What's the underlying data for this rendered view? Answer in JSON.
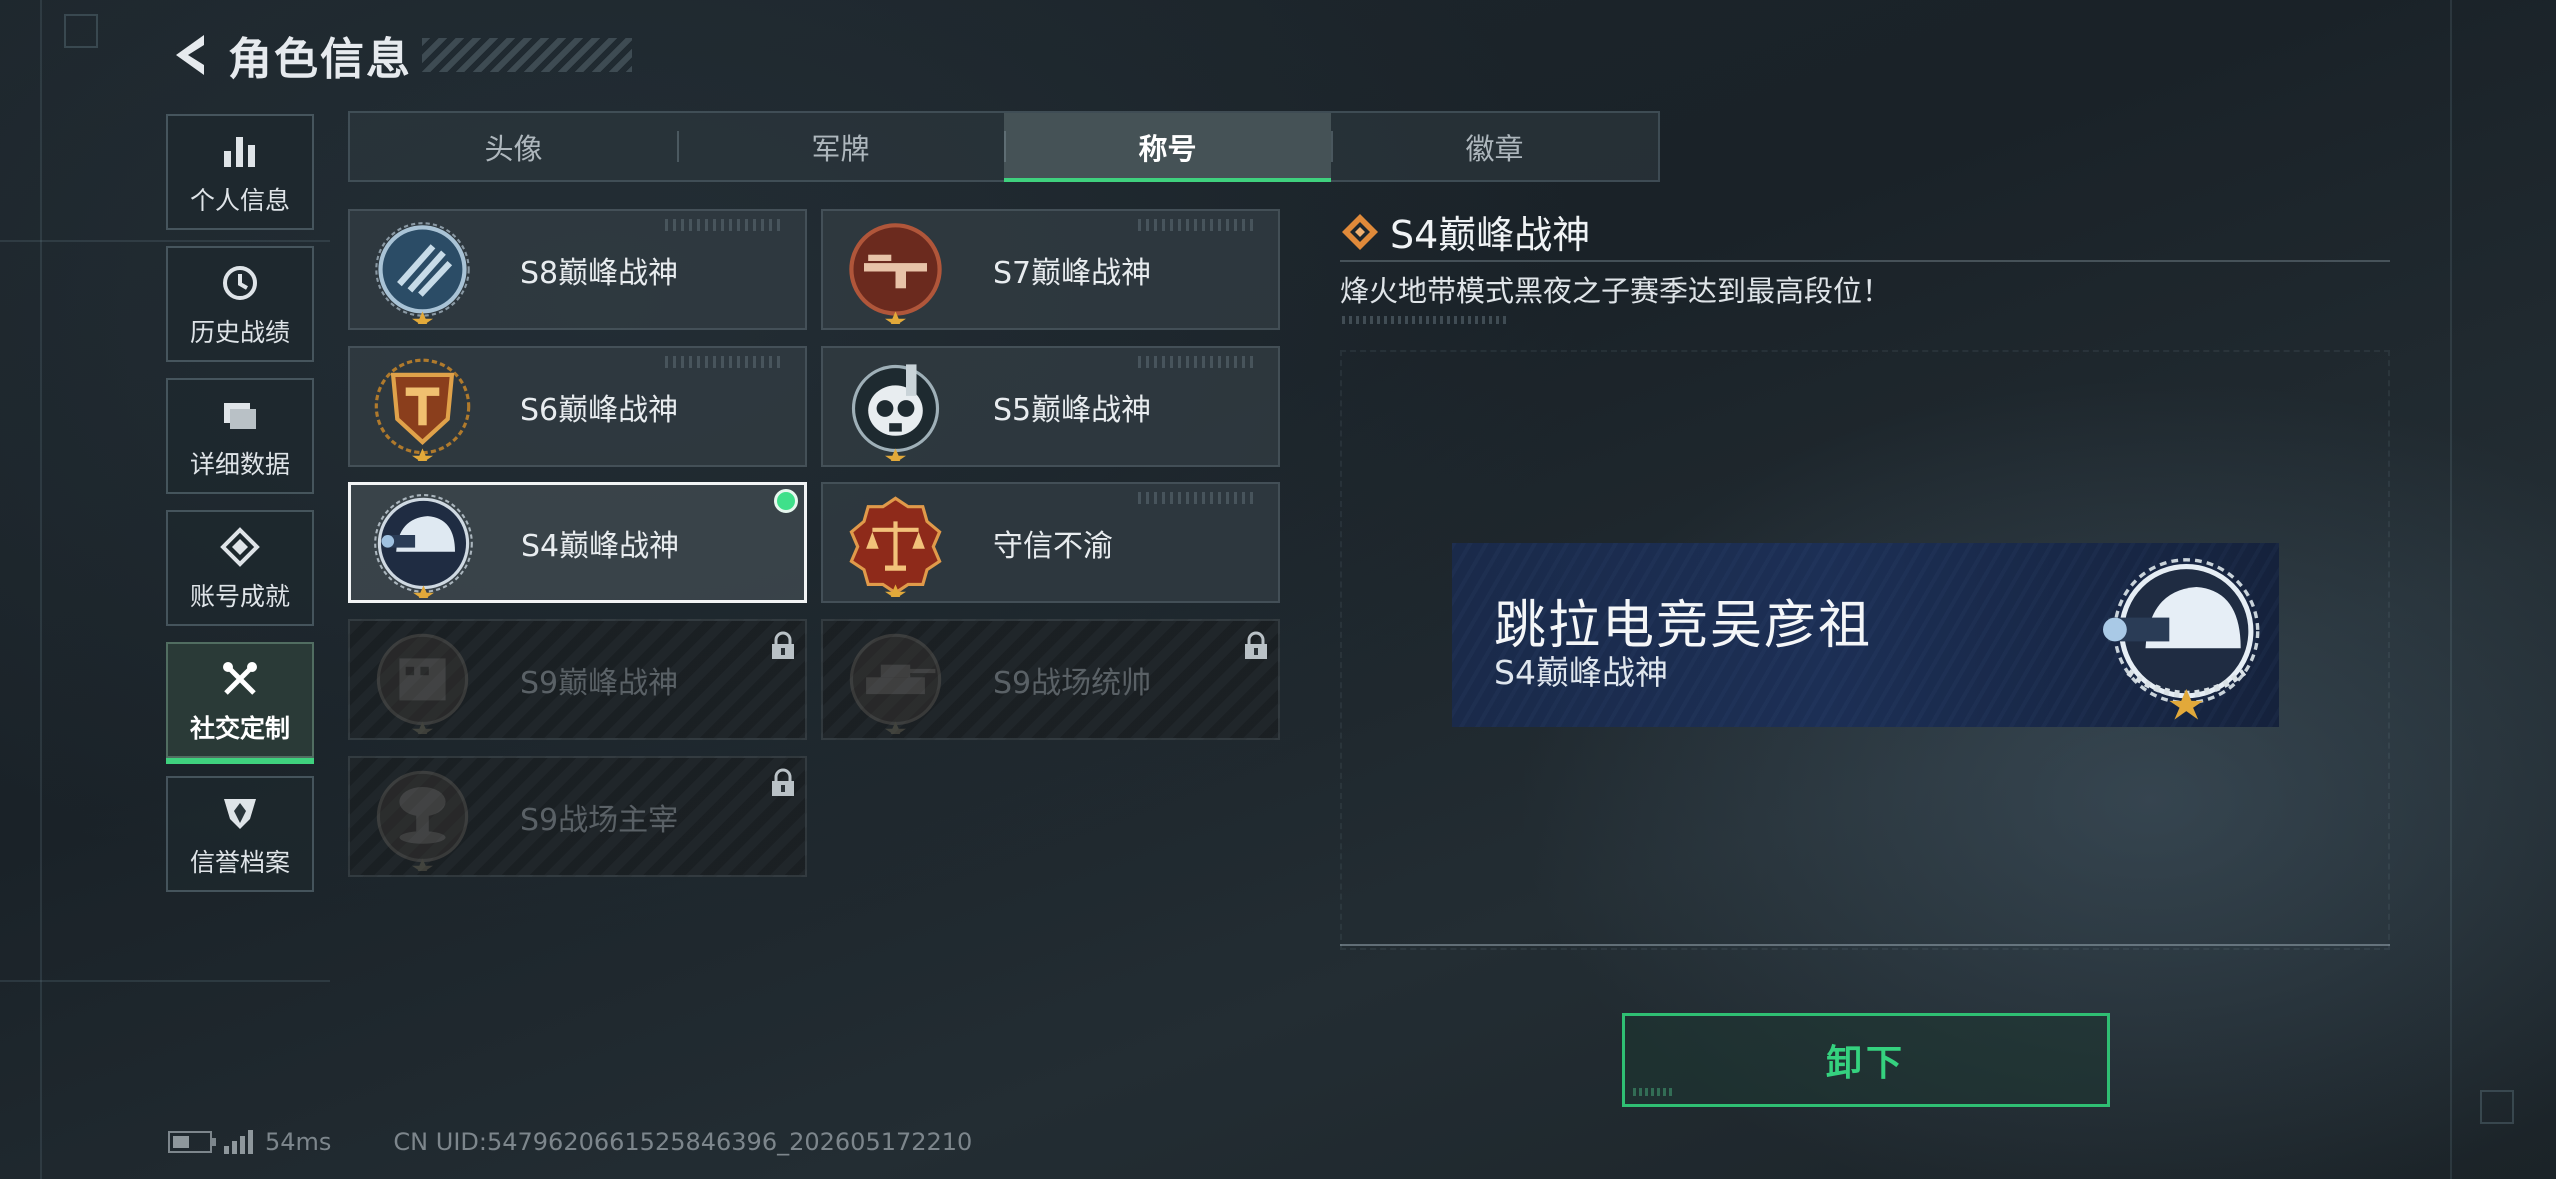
{
  "header": {
    "title": "角色信息"
  },
  "sidebar": {
    "items": [
      {
        "label": "个人信息",
        "icon": "bar-chart-icon"
      },
      {
        "label": "历史战绩",
        "icon": "clock-history-icon"
      },
      {
        "label": "详细数据",
        "icon": "folder-icon"
      },
      {
        "label": "账号成就",
        "icon": "medal-icon"
      },
      {
        "label": "社交定制",
        "icon": "tools-icon",
        "active": true
      },
      {
        "label": "信誉档案",
        "icon": "shield-icon"
      }
    ]
  },
  "tabs": [
    {
      "label": "头像"
    },
    {
      "label": "军牌"
    },
    {
      "label": "称号",
      "active": true
    },
    {
      "label": "徽章"
    }
  ],
  "titles": [
    {
      "name": "S8巅峰战神",
      "emblem": "stripes-emblem-icon",
      "locked": false
    },
    {
      "name": "S7巅峰战神",
      "emblem": "rifle-emblem-icon",
      "locked": false
    },
    {
      "name": "S6巅峰战神",
      "emblem": "t-shield-emblem-icon",
      "locked": false
    },
    {
      "name": "S5巅峰战神",
      "emblem": "skull-mask-emblem-icon",
      "locked": false
    },
    {
      "name": "S4巅峰战神",
      "emblem": "night-vision-helmet-emblem-icon",
      "locked": false,
      "selected": true,
      "equipped": true
    },
    {
      "name": "守信不渝",
      "emblem": "scales-emblem-icon",
      "locked": false
    },
    {
      "name": "S9巅峰战神",
      "emblem": "building-emblem-icon",
      "locked": true
    },
    {
      "name": "S9战场统帅",
      "emblem": "tank-emblem-icon",
      "locked": true
    },
    {
      "name": "S9战场主宰",
      "emblem": "mushroom-cloud-emblem-icon",
      "locked": true
    }
  ],
  "detail": {
    "title": "S4巅峰战神",
    "description": "烽火地带模式黑夜之子赛季达到最高段位！"
  },
  "namecard": {
    "player_name": "跳拉电竞吴彦祖",
    "title": "S4巅峰战神"
  },
  "actions": {
    "unequip_label": "卸下"
  },
  "status": {
    "ping": "54ms",
    "uid": "CN UID:5479620661525846396_202605172210"
  },
  "colors": {
    "accent_green": "#3fd17e",
    "title_diamond_orange": "#e08a3a",
    "namecard_blue": "#1c2f55"
  }
}
